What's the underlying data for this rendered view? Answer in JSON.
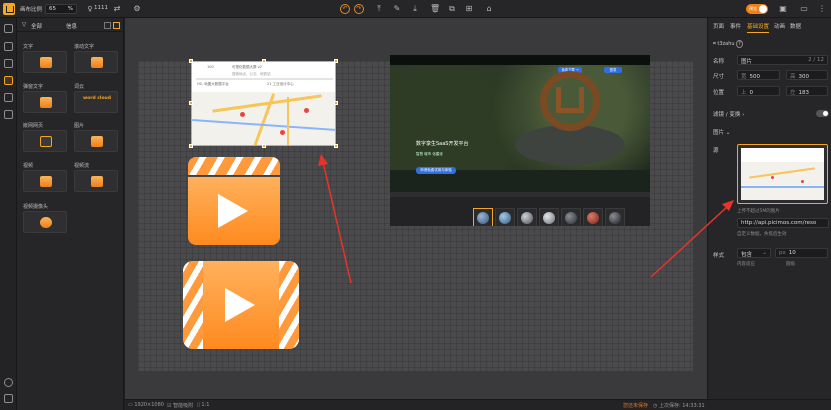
{
  "toolbar": {
    "scale_label": "画布比例",
    "scale_value": "65",
    "scale_unit": "%",
    "count_label": "1111",
    "preview_label": "预览"
  },
  "components_panel": {
    "tabs": [
      "全部",
      "信息"
    ],
    "items": [
      {
        "label": "文字",
        "icon": "text-block-icon"
      },
      {
        "label": "滚动文字",
        "icon": "scroll-text-icon"
      },
      {
        "label": "弹窗文字",
        "icon": "popup-text-icon"
      },
      {
        "label": "词云",
        "icon": "word-cloud-icon",
        "preview_text": "word cloud"
      },
      {
        "label": "嵌网网页",
        "icon": "webpage-icon"
      },
      {
        "label": "图片",
        "icon": "image-icon"
      },
      {
        "label": "视频",
        "icon": "video-icon"
      },
      {
        "label": "视频流",
        "icon": "video-stream-icon"
      },
      {
        "label": "视频摄像头",
        "icon": "camera-icon"
      }
    ]
  },
  "properties": {
    "tabs": [
      "页面",
      "事件",
      "基础设置",
      "动画",
      "数据"
    ],
    "active_tab": "基础设置",
    "component_id": "t3zahu",
    "name_label": "名称",
    "name_value": "图片",
    "name_counter": "2 / 12",
    "size_label": "尺寸",
    "width_prefix": "宽",
    "width_value": "500",
    "height_prefix": "高",
    "height_value": "300",
    "position_label": "位置",
    "top_prefix": "上",
    "top_value": "0",
    "left_prefix": "左",
    "left_value": "183",
    "filter_label": "滤镜 / 变换",
    "image_section": "图片",
    "source_label": "源",
    "upload_note": "上传不超过5M的图片",
    "url_value": "http://api.picimos.com/reso",
    "url_note": "自定义数据，失焦后生效",
    "style_label": "样式",
    "fit_value": "包含",
    "fit_note": "内容适应",
    "radius_prefix": "px",
    "radius_value": "10",
    "radius_note": "圆角"
  },
  "screenshot_content": {
    "hero_title": "数字孪生SaaS开发平台",
    "hero_sub": "智慧 城市 化建设",
    "hero_button": "申请免费试用与体验",
    "nav_button_1": "免费下载 →",
    "nav_button_2": "登录"
  },
  "map_content": {
    "field_1": "100",
    "field_2": "可视化数据大屏 v2",
    "field_3": "搜索地点、公交、地铁站",
    "field_4": "HZ, 地图大数据平台",
    "field_5": "21 工业设计中心"
  },
  "statusbar": {
    "canvas_size": "1920×1080",
    "snap_label": "智能吸附",
    "ratio": "1:1",
    "unsaved": "您还未保存",
    "last_saved_label": "上次保存:",
    "last_saved_time": "14:33:31"
  },
  "colors": {
    "accent": "#f5a623",
    "panel": "#262628",
    "canvas": "#4a4a4c",
    "arrow": "#e8332a"
  }
}
